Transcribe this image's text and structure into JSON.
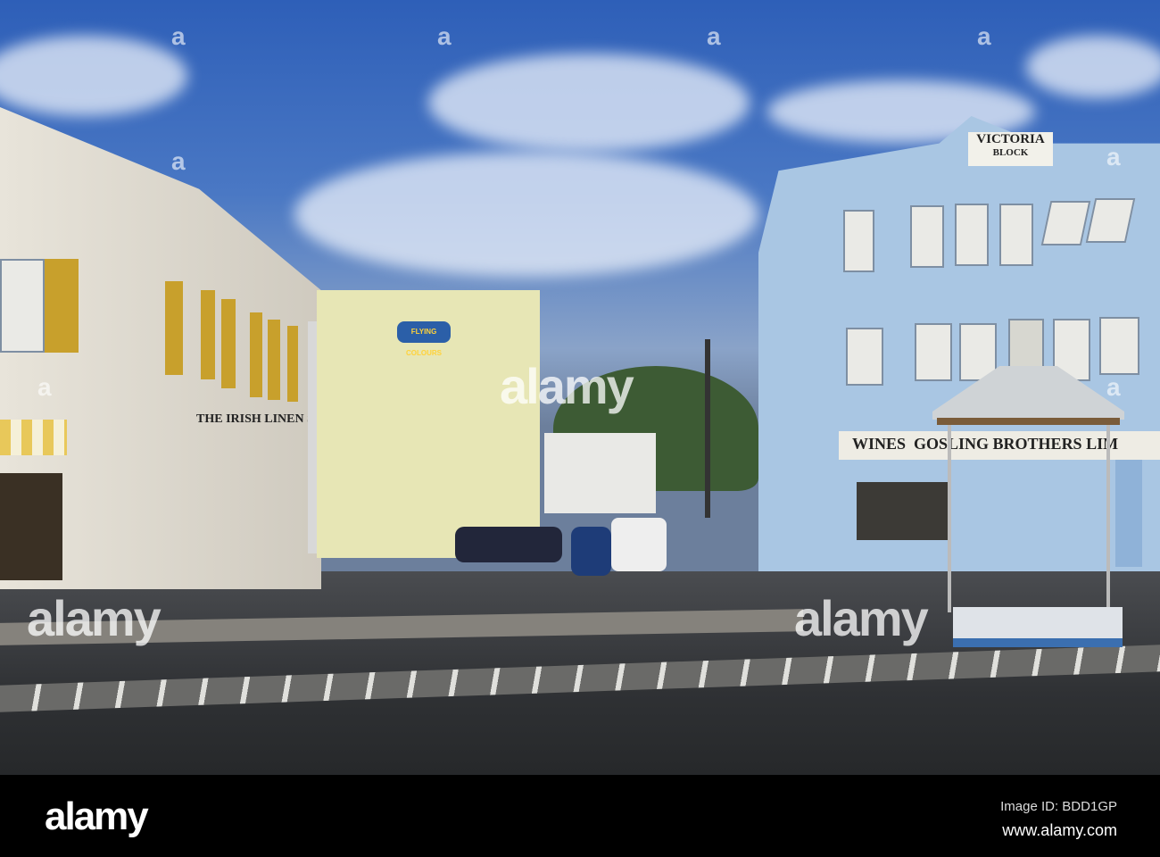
{
  "signs": {
    "victoria": "VICTORIA",
    "block": "BLOCK",
    "gosling": "WINES  GOSLING BROTHERS LIM",
    "irish_linen": "THE IRISH LINEN SHO",
    "flying_colours": "FLYING COLOURS"
  },
  "watermark": {
    "logo": "alamy",
    "mark": "a"
  },
  "footer": {
    "logo": "alamy",
    "image_id": "Image ID: BDD1GP",
    "url": "www.alamy.com"
  }
}
